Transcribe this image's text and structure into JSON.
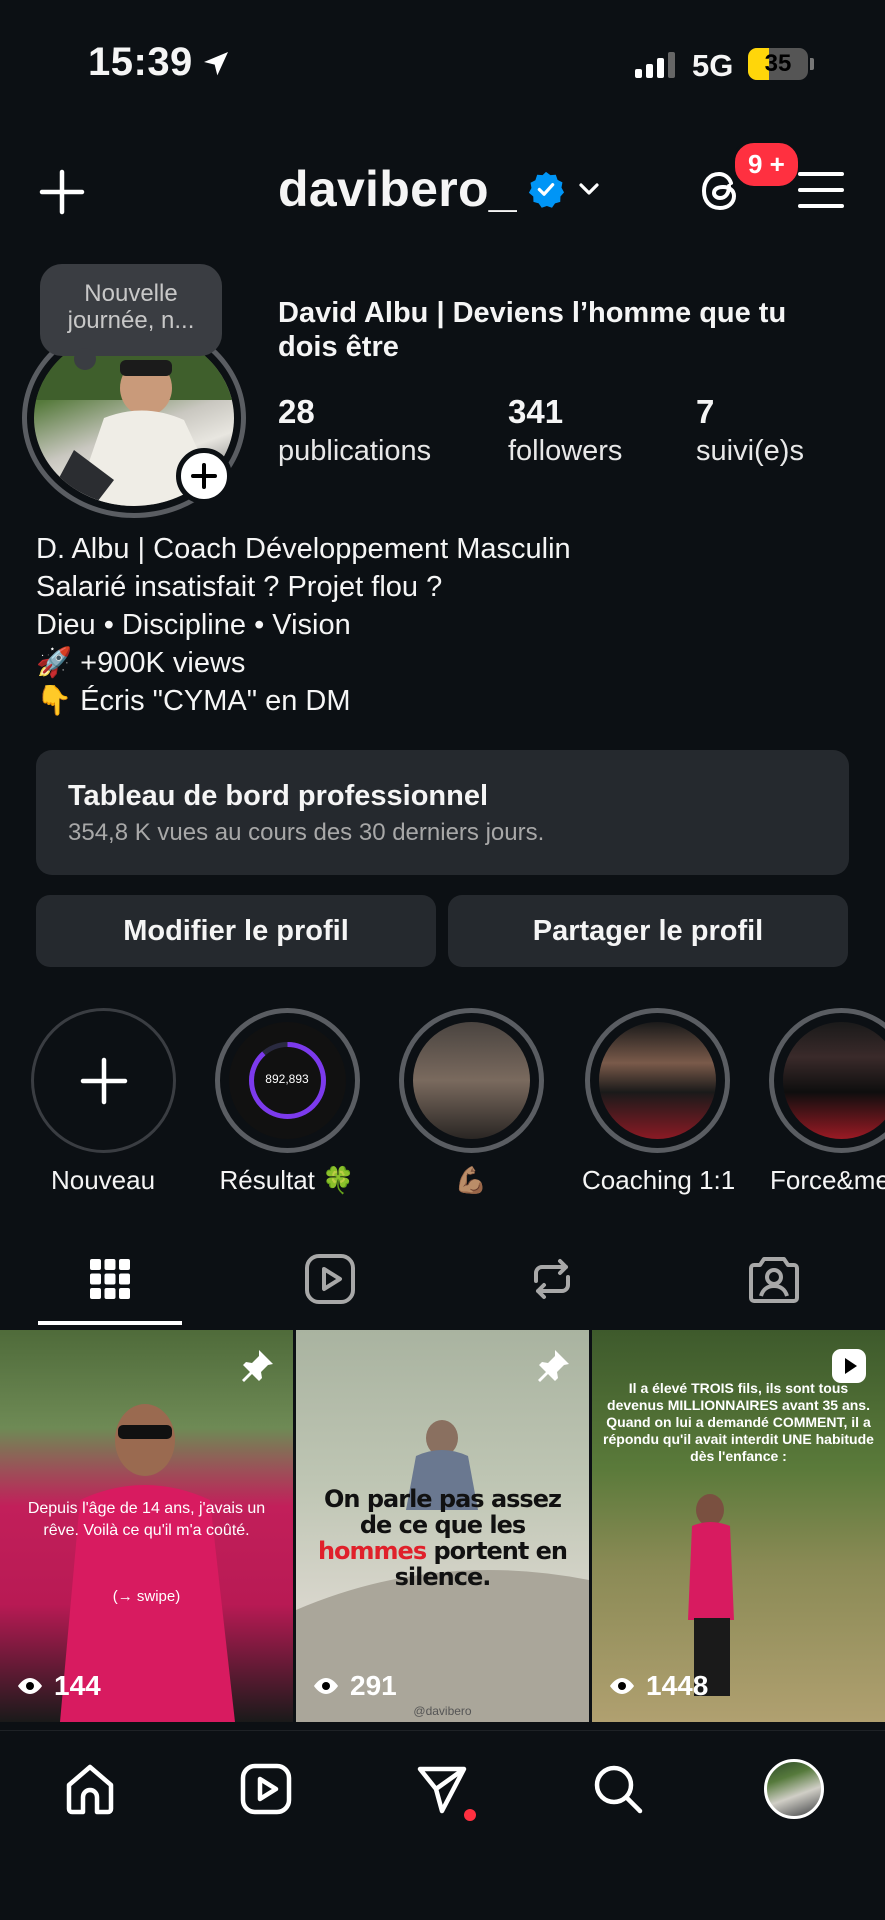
{
  "status_bar": {
    "time": "15:39",
    "network": "5G",
    "battery": "35",
    "battery_level": 0.35
  },
  "header": {
    "username": "davibero_",
    "notification_badge": "9 +"
  },
  "profile": {
    "note": "Nouvelle journée, n...",
    "full_name": "David Albu | Deviens l’homme que tu dois être",
    "stats": [
      {
        "value": "28",
        "label": "publications"
      },
      {
        "value": "341",
        "label": "followers"
      },
      {
        "value": "7",
        "label": "suivi(e)s"
      }
    ],
    "bio": [
      "D. Albu | Coach Développement Masculin",
      "Salarié insatisfait ? Projet flou ?",
      "Dieu • Discipline • Vision",
      "🚀 +900K views",
      "👇 Écris \"CYMA\" en DM"
    ]
  },
  "dashboard": {
    "title": "Tableau de bord professionnel",
    "subtitle": "354,8 K vues au cours des 30 derniers jours."
  },
  "actions": {
    "edit": "Modifier le profil",
    "share": "Partager le profil"
  },
  "highlights": [
    {
      "name": "Nouveau"
    },
    {
      "name": "Résultat 🍀",
      "inner_text": "892,893"
    },
    {
      "name": "💪🏽"
    },
    {
      "name": "Coaching 1:1"
    },
    {
      "name": "Force&men"
    }
  ],
  "tabs": [
    "grid",
    "reels",
    "reposts",
    "tagged"
  ],
  "posts": [
    {
      "views": "144",
      "caption": "Depuis l'âge de 14 ans, j'avais un rêve. Voilà ce qu'il m'a coûté.",
      "sub": "(→ swipe)",
      "pinned": true
    },
    {
      "views": "291",
      "caption_a": "On parle pas assez de ce que les ",
      "caption_highlight": "hommes",
      "caption_b": " portent en silence.",
      "watermark": "@davibero",
      "pinned": true
    },
    {
      "views": "1448",
      "caption": "Il a élevé TROIS fils, ils sont tous devenus MILLIONNAIRES avant 35 ans. Quand on lui a demandé COMMENT, il a répondu qu'il avait interdit UNE habitude dès l'enfance :",
      "reel": true
    }
  ],
  "colors": {
    "background": "#0c1014",
    "surface": "#25292e",
    "verified": "#0095f6",
    "badge": "#ff3040",
    "battery": "#ffd60a",
    "story_ring": "#7c3aed"
  }
}
